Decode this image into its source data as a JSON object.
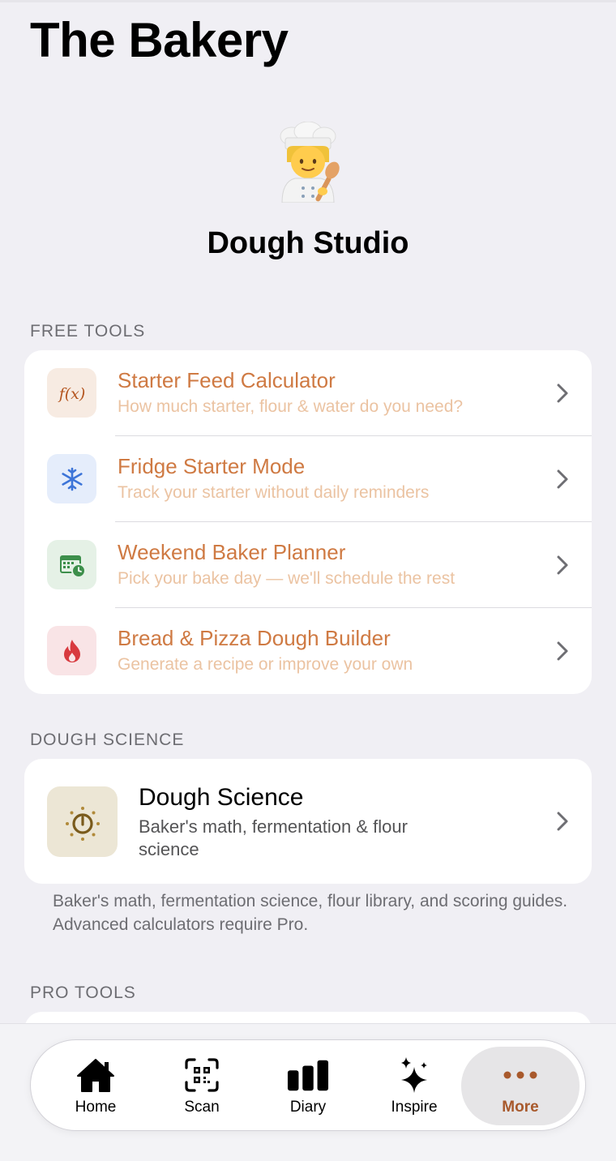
{
  "page": {
    "title": "The Bakery"
  },
  "hero": {
    "emoji_icon": "chef-emoji",
    "title": "Dough Studio"
  },
  "free_tools": {
    "header": "FREE TOOLS",
    "items": [
      {
        "title": "Starter Feed Calculator",
        "subtitle": "How much starter, flour & water do you need?",
        "icon": "function-icon",
        "tile_color": "#f7ebe2"
      },
      {
        "title": "Fridge Starter Mode",
        "subtitle": "Track your starter without daily reminders",
        "icon": "snowflake-icon",
        "tile_color": "#e5edfb"
      },
      {
        "title": "Weekend Baker Planner",
        "subtitle": "Pick your bake day — we'll schedule the rest",
        "icon": "calendar-clock-icon",
        "tile_color": "#e5f1e6"
      },
      {
        "title": "Bread & Pizza Dough Builder",
        "subtitle": "Generate a recipe or improve your own",
        "icon": "flame-icon",
        "tile_color": "#f9e4e6"
      }
    ]
  },
  "dough_science": {
    "header": "DOUGH SCIENCE",
    "card": {
      "title": "Dough Science",
      "subtitle": "Baker's math, fermentation & flour science",
      "icon": "timer-icon"
    },
    "footnote": "Baker's math, fermentation science, flour library, and scoring guides. Advanced calculators require Pro."
  },
  "pro_tools": {
    "header": "PRO TOOLS"
  },
  "tabbar": {
    "tabs": [
      {
        "label": "Home",
        "icon": "home-icon"
      },
      {
        "label": "Scan",
        "icon": "qr-scan-icon"
      },
      {
        "label": "Diary",
        "icon": "bar-chart-icon"
      },
      {
        "label": "Inspire",
        "icon": "sparkles-icon"
      },
      {
        "label": "More",
        "icon": "ellipsis-icon",
        "active": true
      }
    ]
  },
  "colors": {
    "accent": "#cf7a43",
    "accent_muted": "#ebc3a2",
    "active_tab": "#a8592c",
    "background": "#f0eff4"
  }
}
